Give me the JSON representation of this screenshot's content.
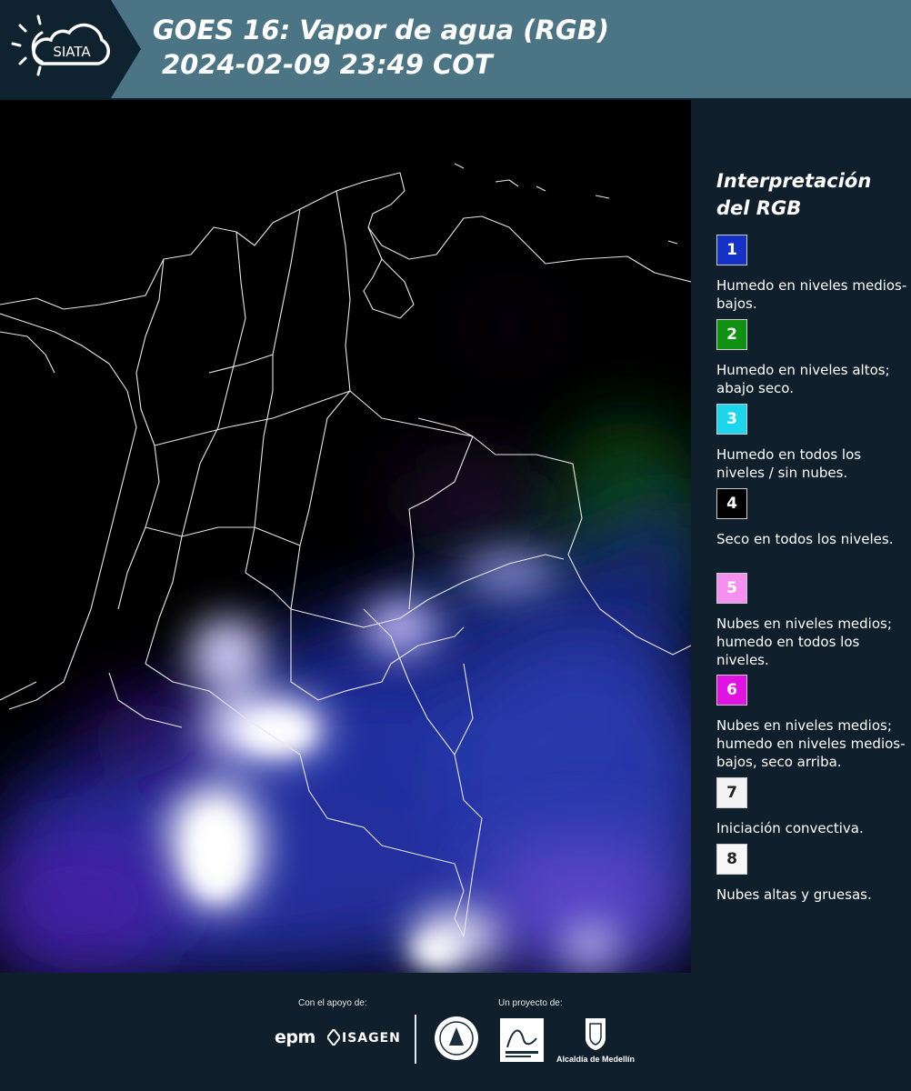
{
  "header": {
    "logo_text": "SIATA",
    "title_line1": "GOES 16: Vapor de agua (RGB)",
    "title_line2": "2024-02-09 23:49 COT",
    "background_color": "#4b7585",
    "logo_panel_color": "#0f2230"
  },
  "legend": {
    "title_line1": "Interpretación",
    "title_line2": "del RGB",
    "items": [
      {
        "number": "1",
        "color": "#1432c8",
        "text_color": "#ffffff",
        "description": "Humedo en niveles medios-bajos."
      },
      {
        "number": "2",
        "color": "#119111",
        "text_color": "#ffffff",
        "description": "Humedo en niveles altos; abajo seco."
      },
      {
        "number": "3",
        "color": "#1cd6ee",
        "text_color": "#ffffff",
        "description": "Humedo en todos los niveles / sin nubes."
      },
      {
        "number": "4",
        "color": "#000000",
        "text_color": "#ffffff",
        "description": "Seco en todos los niveles."
      },
      {
        "number": "5",
        "color": "#f690f0",
        "text_color": "#ffffff",
        "description": "Nubes en niveles medios; humedo en todos los niveles."
      },
      {
        "number": "6",
        "color": "#e112e4",
        "text_color": "#ffffff",
        "description": "Nubes en niveles medios; humedo en niveles medios-bajos, seco arriba."
      },
      {
        "number": "7",
        "color": "#f4f4f4",
        "text_color": "#222222",
        "description": "Iniciación convectiva."
      },
      {
        "number": "8",
        "color": "#f7f7f7",
        "text_color": "#222222",
        "description": "Nubes altas y gruesas."
      }
    ]
  },
  "footer": {
    "support_caption": "Con el apoyo de:",
    "project_caption": "Un proyecto de:",
    "brand_epm": "epm",
    "brand_isagen": "ISAGEN",
    "brand_alcaldia": "Alcaldía de Medellín"
  }
}
